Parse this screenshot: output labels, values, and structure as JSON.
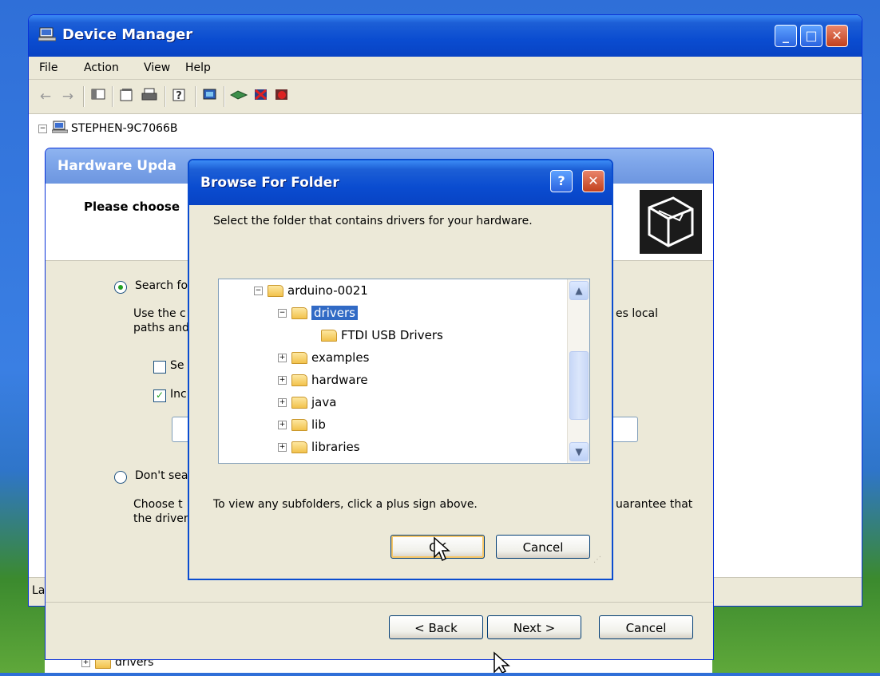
{
  "device_manager": {
    "title": "Device Manager",
    "menu": [
      "File",
      "Action",
      "View",
      "Help"
    ],
    "toolbar_icons": [
      "back-arrow-icon",
      "forward-arrow-icon",
      "console-tree-icon",
      "properties-icon",
      "print-icon",
      "help-icon",
      "scan-hardware-icon",
      "update-driver-icon",
      "uninstall-icon",
      "disable-icon"
    ],
    "tree_root": "STEPHEN-9C7066B",
    "status_text": "Lau",
    "behind_text": "drivers"
  },
  "wizard": {
    "title": "Hardware Upda",
    "header_title": "Please choose",
    "option_search": "Search fo",
    "use_text_line1": "Use the c",
    "use_text_line2": "paths and",
    "use_text_right": "es local",
    "checkbox_search": "Se",
    "checkbox_include": "Inc",
    "option_dont": "Don't sea",
    "choose_line1": "Choose t",
    "choose_line2": "the driver",
    "choose_right": "uarantee that",
    "back_label": "< Back",
    "next_label": "Next >",
    "cancel_label": "Cancel"
  },
  "browse": {
    "title": "Browse For Folder",
    "help_label": "?",
    "prompt": "Select the folder that contains drivers for your hardware.",
    "hint": "To view any subfolders, click a plus sign above.",
    "ok_label": "OK",
    "cancel_label": "Cancel",
    "tree": [
      {
        "label": "arduino-0021",
        "expander": "−"
      },
      {
        "label": "drivers",
        "expander": "−",
        "selected": true
      },
      {
        "label": "FTDI USB Drivers",
        "expander": ""
      },
      {
        "label": "examples",
        "expander": "+"
      },
      {
        "label": "hardware",
        "expander": "+"
      },
      {
        "label": "java",
        "expander": "+"
      },
      {
        "label": "lib",
        "expander": "+"
      },
      {
        "label": "libraries",
        "expander": "+"
      }
    ]
  },
  "colors": {
    "xp_blue": "#0a4cd0",
    "selection": "#316ac5",
    "dialog_face": "#ece9d8"
  }
}
